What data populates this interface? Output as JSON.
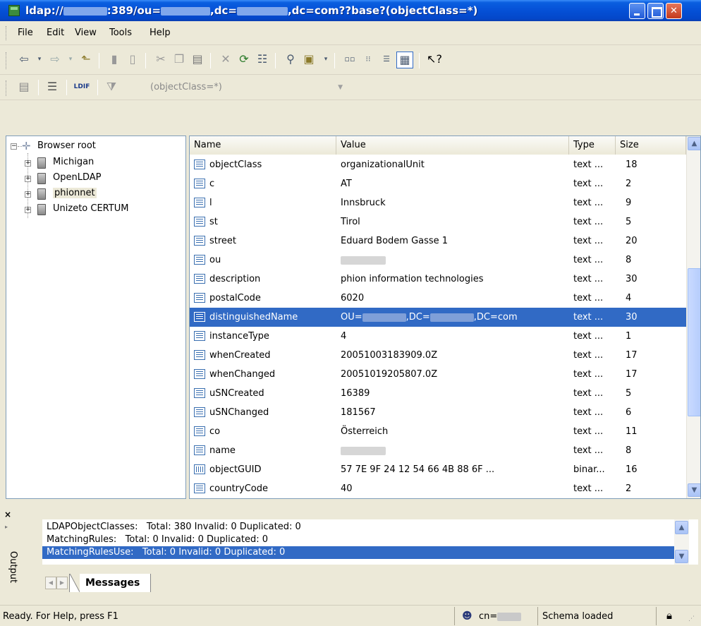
{
  "window": {
    "title_prefix": "ldap://",
    "title_mid1": ":389/ou=",
    "title_mid2": ",dc=",
    "title_suffix": ",dc=com??base?(objectClass=*)"
  },
  "menu": [
    "File",
    "Edit",
    "View",
    "Tools",
    "Help"
  ],
  "toolbar2": {
    "ldif_label": "LDIF",
    "filter_value": "(objectClass=*)"
  },
  "tree": {
    "root": "Browser root",
    "servers": [
      "Michigan",
      "OpenLDAP",
      "phionnet",
      "Unizeto CERTUM"
    ]
  },
  "grid": {
    "columns": [
      "Name",
      "Value",
      "Type",
      "Size"
    ],
    "rows": [
      {
        "name": "objectClass",
        "value": "organizationalUnit",
        "type": "text ...",
        "size": "18",
        "icon": "text-attribute-icon"
      },
      {
        "name": "c",
        "value": "AT",
        "type": "text ...",
        "size": "2",
        "icon": "text-attribute-icon"
      },
      {
        "name": "l",
        "value": "Innsbruck",
        "type": "text ...",
        "size": "9",
        "icon": "text-attribute-icon"
      },
      {
        "name": "st",
        "value": "Tirol",
        "type": "text ...",
        "size": "5",
        "icon": "text-attribute-icon"
      },
      {
        "name": "street",
        "value": "Eduard Bodem Gasse 1",
        "type": "text ...",
        "size": "20",
        "icon": "text-attribute-icon"
      },
      {
        "name": "ou",
        "value": "",
        "type": "text ...",
        "size": "8",
        "icon": "text-attribute-icon"
      },
      {
        "name": "description",
        "value": "phion information technologies",
        "type": "text ...",
        "size": "30",
        "icon": "text-attribute-icon"
      },
      {
        "name": "postalCode",
        "value": "6020",
        "type": "text ...",
        "size": "4",
        "icon": "text-attribute-icon"
      },
      {
        "name": "distinguishedName",
        "value_part1": "OU=",
        "value_part2": ",DC=",
        "value_part3": ",DC=com",
        "type": "text ...",
        "size": "30",
        "icon": "text-attribute-icon",
        "selected": true
      },
      {
        "name": "instanceType",
        "value": "4",
        "type": "text ...",
        "size": "1",
        "icon": "text-attribute-icon"
      },
      {
        "name": "whenCreated",
        "value": "20051003183909.0Z",
        "type": "text ...",
        "size": "17",
        "icon": "text-attribute-icon"
      },
      {
        "name": "whenChanged",
        "value": "20051019205807.0Z",
        "type": "text ...",
        "size": "17",
        "icon": "text-attribute-icon"
      },
      {
        "name": "uSNCreated",
        "value": "16389",
        "type": "text ...",
        "size": "5",
        "icon": "text-attribute-icon"
      },
      {
        "name": "uSNChanged",
        "value": "181567",
        "type": "text ...",
        "size": "6",
        "icon": "text-attribute-icon"
      },
      {
        "name": "co",
        "value": "Österreich",
        "type": "text ...",
        "size": "11",
        "icon": "text-attribute-icon"
      },
      {
        "name": "name",
        "value": "",
        "type": "text ...",
        "size": "8",
        "icon": "text-attribute-icon"
      },
      {
        "name": "objectGUID",
        "value": "57 7E 9F 24 12 54 66 4B 88 6F ...",
        "type": "binar...",
        "size": "16",
        "icon": "binary-attribute-icon"
      },
      {
        "name": "countryCode",
        "value": "40",
        "type": "text ...",
        "size": "2",
        "icon": "text-attribute-icon"
      }
    ]
  },
  "output": {
    "label": "Output",
    "rows": [
      {
        "label": "LDAPObjectClasses:",
        "stats": "Total: 380 Invalid: 0 Duplicated: 0"
      },
      {
        "label": "MatchingRules:",
        "stats": "Total: 0 Invalid: 0 Duplicated: 0"
      },
      {
        "label": "MatchingRulesUse:",
        "stats": "Total: 0 Invalid: 0 Duplicated: 0",
        "selected": true
      }
    ],
    "tab": "Messages"
  },
  "status": {
    "ready": "Ready. For Help, press F1",
    "user_prefix": "cn=",
    "schema": "Schema loaded"
  },
  "colors": {
    "selection": "#316AC5",
    "titlebar": "#0550D6",
    "chrome": "#ECE9D8"
  }
}
